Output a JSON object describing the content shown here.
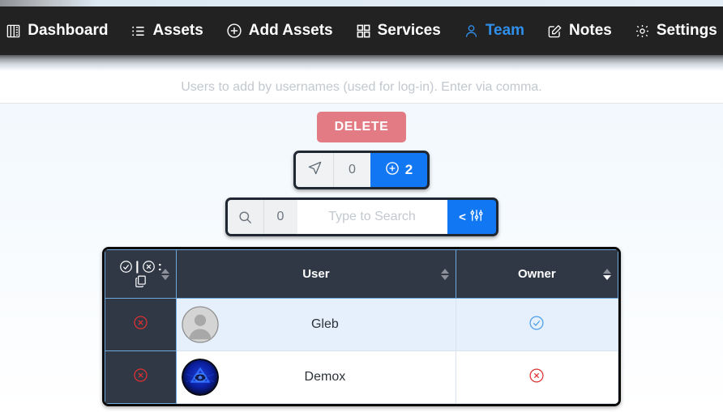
{
  "nav": {
    "items": [
      {
        "label": "Dashboard",
        "icon": "book-icon",
        "active": false
      },
      {
        "label": "Assets",
        "icon": "list-icon",
        "active": false
      },
      {
        "label": "Add Assets",
        "icon": "plus-circle-icon",
        "active": false
      },
      {
        "label": "Services",
        "icon": "grid-icon",
        "active": false
      },
      {
        "label": "Team",
        "icon": "user-icon",
        "active": true
      },
      {
        "label": "Notes",
        "icon": "pencil-square-icon",
        "active": false
      },
      {
        "label": "Settings",
        "icon": "gear-icon",
        "active": false
      }
    ]
  },
  "subheader": {
    "placeholder": "Users to add by usernames (used for log-in). Enter via comma.",
    "value": ""
  },
  "actions": {
    "delete_label": "DELETE"
  },
  "toggle": {
    "send_icon": "paper-plane-icon",
    "send_count": "0",
    "add_icon": "plus-circle-icon",
    "add_count": "2"
  },
  "search": {
    "icon": "search-icon",
    "count": "0",
    "placeholder": "Type to Search",
    "value": "",
    "filter_prefix": "<",
    "filter_icon": "sliders-icon"
  },
  "table": {
    "headers": {
      "actions": {
        "select_all_icon": "check-circle-icon",
        "deselect_all_icon": "x-circle-icon",
        "separator": "|",
        "colon": ":",
        "copy_icon": "copy-icon"
      },
      "user": "User",
      "owner": "Owner"
    },
    "rows": [
      {
        "delete_icon": "x-circle-icon",
        "avatar": "default-avatar",
        "name": "Gleb",
        "owner_state": "yes",
        "owner_icon": "check-circle-icon",
        "highlighted": true
      },
      {
        "delete_icon": "x-circle-icon",
        "avatar": "eye-logo-avatar",
        "name": "Demox",
        "owner_state": "no",
        "owner_icon": "x-circle-icon",
        "highlighted": false
      }
    ]
  },
  "colors": {
    "navbar_bg": "#222222",
    "accent_blue": "#1277f2",
    "active_nav": "#2f8fea",
    "delete_red": "#e27b84",
    "table_header_bg": "#303845",
    "row_highlight": "#e6f0fd",
    "danger": "#e03131",
    "owner_check": "#4a9eea"
  }
}
